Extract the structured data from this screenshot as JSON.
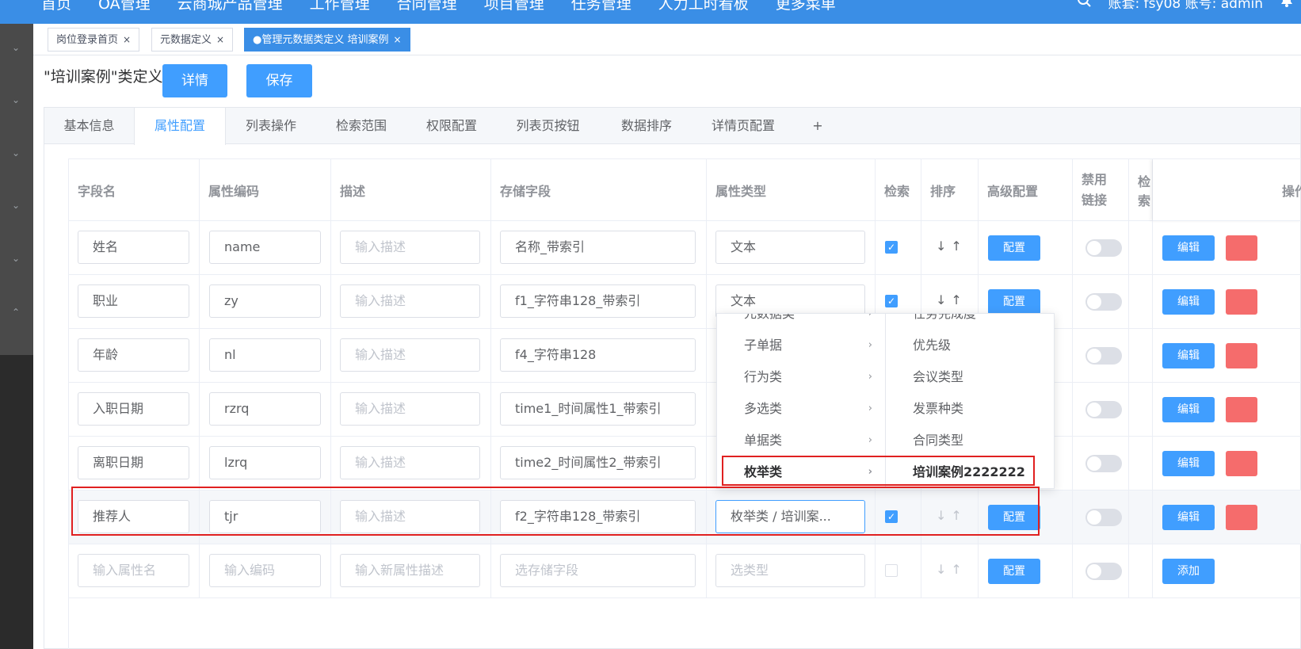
{
  "topbar": {
    "nav": [
      "首页",
      "OA管理",
      "云商城产品管理",
      "工作管理",
      "合同管理",
      "项目管理",
      "任务管理",
      "人力工时看板",
      "更多菜单"
    ],
    "account": "账套: fsy08  账号: admin"
  },
  "page_tabs": [
    {
      "label": "岗位登录首页",
      "close": "×"
    },
    {
      "label": "元数据定义",
      "close": "×"
    },
    {
      "label": "●管理元数据类定义 培训案例",
      "close": "×"
    }
  ],
  "header": {
    "title": "\"培训案例\"类定义",
    "details_btn": "详情",
    "save_btn": "保存"
  },
  "card_tabs": [
    "基本信息",
    "属性配置",
    "列表操作",
    "检索范围",
    "权限配置",
    "列表页按钮",
    "数据排序",
    "详情页配置",
    "+"
  ],
  "columns": [
    "字段名",
    "属性编码",
    "描述",
    "存储字段",
    "属性类型",
    "检索",
    "排序",
    "高级配置",
    "禁用链接",
    "检索",
    "操作"
  ],
  "rows": [
    {
      "name": "姓名",
      "code": "name",
      "desc_ph": "输入描述",
      "storage": "名称_带索引",
      "type": "文本",
      "search": true,
      "cfg": "配置",
      "edit": "编辑"
    },
    {
      "name": "职业",
      "code": "zy",
      "desc_ph": "输入描述",
      "storage": "f1_字符串128_带索引",
      "type": "文本",
      "search": true,
      "cfg": "配置",
      "edit": "编辑"
    },
    {
      "name": "年龄",
      "code": "nl",
      "desc_ph": "输入描述",
      "storage": "f4_字符串128",
      "type": "",
      "search": false,
      "cfg": "",
      "edit": "编辑"
    },
    {
      "name": "入职日期",
      "code": "rzrq",
      "desc_ph": "输入描述",
      "storage": "time1_时间属性1_带索引",
      "type": "",
      "search": false,
      "cfg": "",
      "edit": "编辑"
    },
    {
      "name": "离职日期",
      "code": "lzrq",
      "desc_ph": "输入描述",
      "storage": "time2_时间属性2_带索引",
      "type": "",
      "search": false,
      "cfg": "",
      "edit": "编辑"
    },
    {
      "name": "推荐人",
      "code": "tjr",
      "desc_ph": "输入描述",
      "storage": "f2_字符串128_带索引",
      "type": "枚举类 / 培训案...",
      "search": true,
      "cfg": "配置",
      "edit": "编辑"
    }
  ],
  "new_row": {
    "name_ph": "输入属性名",
    "code_ph": "输入编码",
    "desc_ph": "输入新属性描述",
    "storage_ph": "选存储字段",
    "type_ph": "选类型",
    "cfg": "配置",
    "add": "添加"
  },
  "sort_glyph": "↓↑",
  "cascader": {
    "col1": [
      "元数据类",
      "子单据",
      "行为类",
      "多选类",
      "单据类",
      "枚举类"
    ],
    "col2": [
      "任务完成度",
      "优先级",
      "会议类型",
      "发票种类",
      "合同类型",
      "培训案例2222222"
    ]
  }
}
